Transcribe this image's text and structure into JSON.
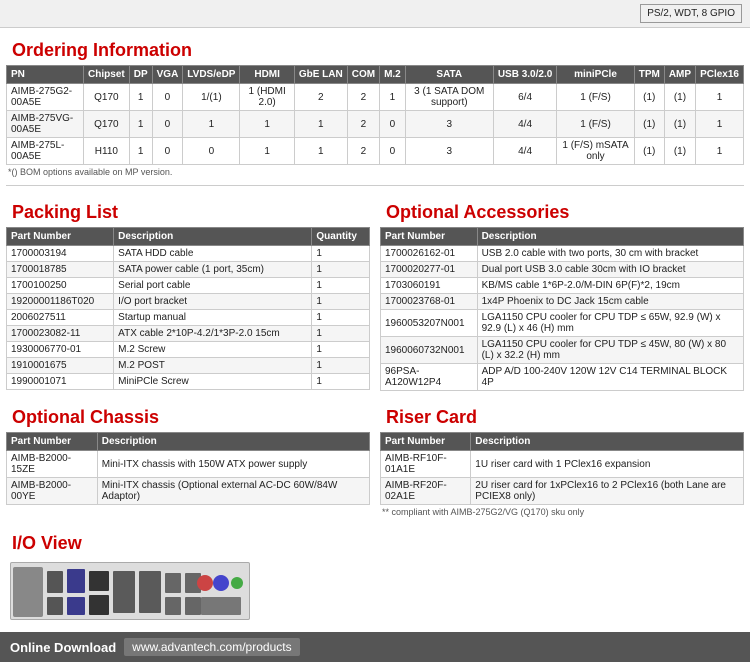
{
  "topbar": {
    "specs": "PS/2, WDT, 8 GPIO"
  },
  "ordering": {
    "title": "Ordering Information",
    "columns": [
      "PN",
      "Chipset",
      "DP",
      "VGA",
      "LVDS/eDP",
      "HDMI",
      "GbE LAN",
      "COM",
      "M.2",
      "SATA",
      "USB 3.0/2.0",
      "miniPCle",
      "TPM",
      "AMP",
      "PClex16"
    ],
    "rows": [
      [
        "AIMB-275G2-00A5E",
        "Q170",
        "1",
        "0",
        "1/(1)",
        "1 (HDMI 2.0)",
        "2",
        "2",
        "1",
        "3 (1 SATA DOM support)",
        "6/4",
        "1 (F/S)",
        "(1)",
        "(1)",
        "1"
      ],
      [
        "AIMB-275VG-00A5E",
        "Q170",
        "1",
        "0",
        "1",
        "1",
        "1",
        "2",
        "0",
        "3",
        "4/4",
        "1 (F/S)",
        "(1)",
        "(1)",
        "1"
      ],
      [
        "AIMB-275L-00A5E",
        "H110",
        "1",
        "0",
        "0",
        "1",
        "1",
        "2",
        "0",
        "3",
        "4/4",
        "1 (F/S) mSATA only",
        "(1)",
        "(1)",
        "1"
      ]
    ],
    "bom_note": "*() BOM options available on MP version."
  },
  "packing": {
    "title": "Packing List",
    "columns": [
      "Part Number",
      "Description",
      "Quantity"
    ],
    "rows": [
      [
        "1700003194",
        "SATA HDD cable",
        "1"
      ],
      [
        "1700018785",
        "SATA power cable (1 port, 35cm)",
        "1"
      ],
      [
        "1700100250",
        "Serial port cable",
        "1"
      ],
      [
        "19200001186T020",
        "I/O port bracket",
        "1"
      ],
      [
        "2006027511",
        "Startup manual",
        "1"
      ],
      [
        "1700023082-11",
        "ATX cable 2*10P-4.2/1*3P-2.0 15cm",
        "1"
      ],
      [
        "1930006770-01",
        "M.2 Screw",
        "1"
      ],
      [
        "1910001675",
        "M.2 POST",
        "1"
      ],
      [
        "1990001071",
        "MiniPCle Screw",
        "1"
      ]
    ]
  },
  "optional_chassis": {
    "title": "Optional Chassis",
    "columns": [
      "Part Number",
      "Description"
    ],
    "rows": [
      [
        "AIMB-B2000-15ZE",
        "Mini-ITX chassis with 150W ATX power supply"
      ],
      [
        "AIMB-B2000-00YE",
        "Mini-ITX chassis (Optional external AC-DC 60W/84W Adaptor)"
      ]
    ]
  },
  "optional_accessories": {
    "title": "Optional Accessories",
    "columns": [
      "Part Number",
      "Description"
    ],
    "rows": [
      [
        "1700026162-01",
        "USB 2.0 cable with two ports, 30 cm with bracket"
      ],
      [
        "1700020277-01",
        "Dual port USB 3.0 cable 30cm with IO bracket"
      ],
      [
        "1703060191",
        "KB/MS cable 1*6P-2.0/M-DIN 6P(F)*2, 19cm"
      ],
      [
        "1700023768-01",
        "1x4P Phoenix to DC Jack 15cm cable"
      ],
      [
        "1960053207N001",
        "LGA1150 CPU cooler for CPU TDP ≤ 65W, 92.9 (W) x 92.9 (L) x 46 (H) mm"
      ],
      [
        "1960060732N001",
        "LGA1150 CPU cooler for CPU TDP ≤ 45W, 80 (W) x 80 (L) x 32.2 (H) mm"
      ],
      [
        "96PSA-A120W12P4",
        "ADP A/D 100-240V 120W 12V C14 TERMINAL BLOCK 4P"
      ]
    ]
  },
  "riser_card": {
    "title": "Riser Card",
    "columns": [
      "Part Number",
      "Description"
    ],
    "rows": [
      [
        "AIMB-RF10F-01A1E",
        "1U riser card with 1 PClex16 expansion"
      ],
      [
        "AIMB-RF20F-02A1E",
        "2U riser card for 1xPClex16 to 2 PClex16 (both Lane are PCIEX8 only)"
      ]
    ],
    "note": "** compliant with AIMB-275G2/VG (Q170) sku only"
  },
  "io_view": {
    "title": "I/O View"
  },
  "bottom": {
    "label": "Online Download",
    "url": "www.advantech.com/products"
  }
}
